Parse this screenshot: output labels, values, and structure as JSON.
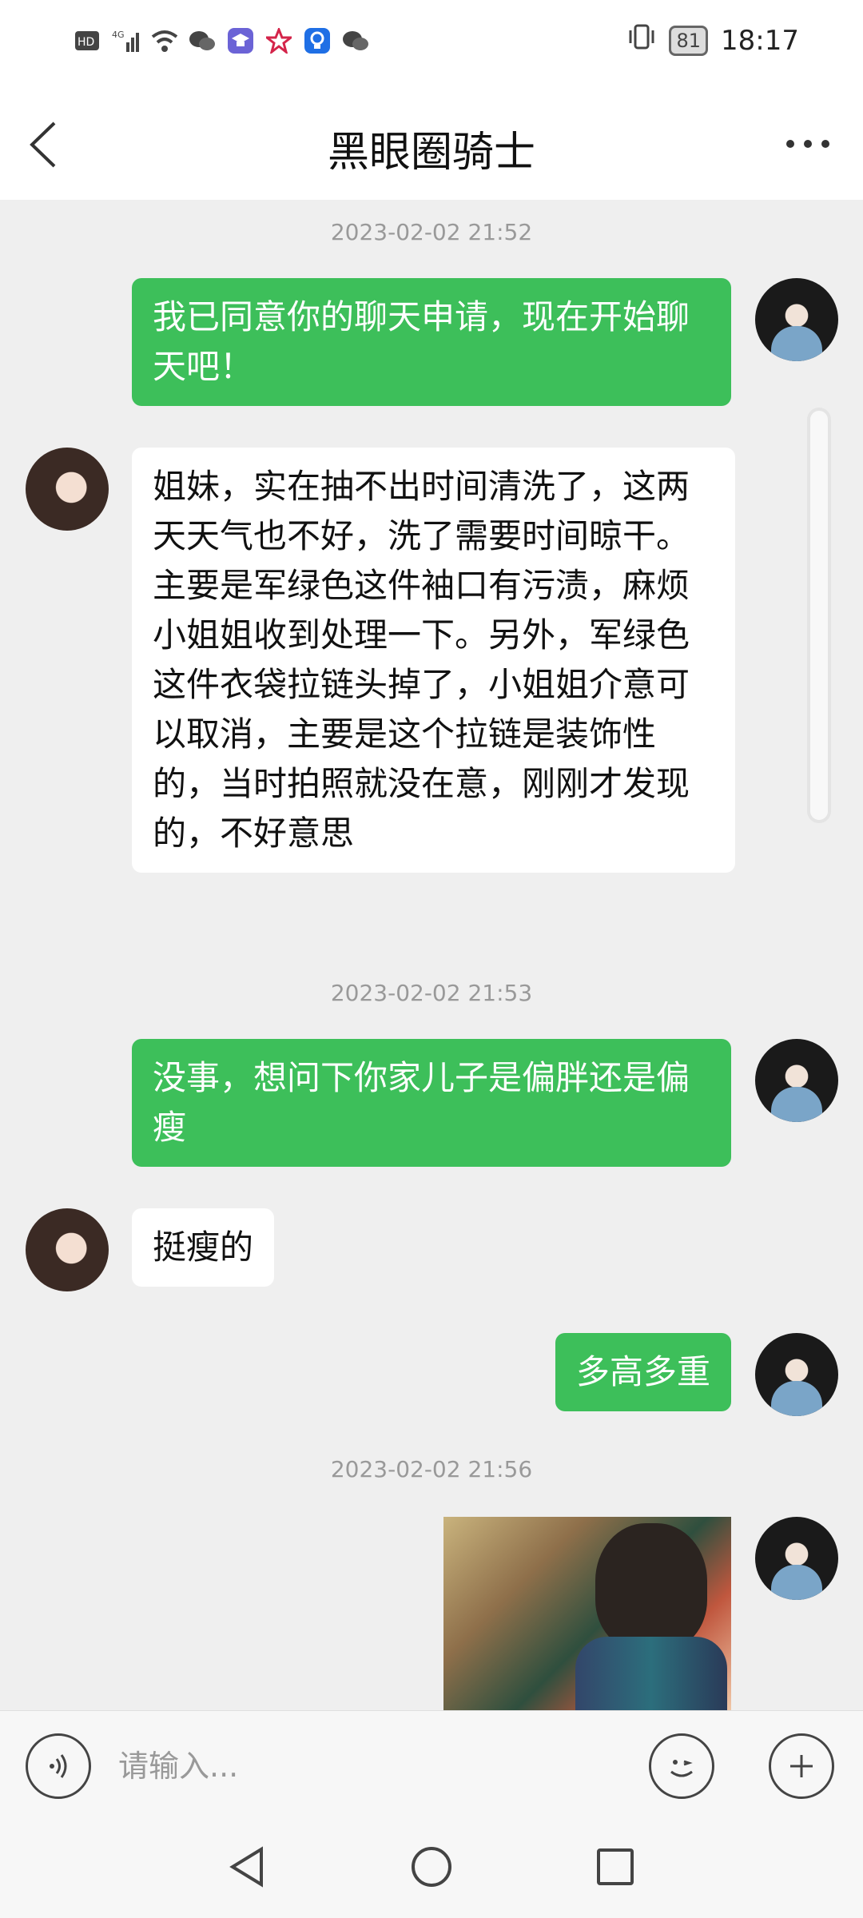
{
  "status_bar": {
    "left_icons": [
      "hd-icon",
      "4g-signal-icon",
      "wifi-icon",
      "wechat-icon",
      "graduation-cap-app-icon",
      "star-app-icon",
      "bulb-app-icon",
      "wechat-icon"
    ],
    "battery": "81",
    "time": "18:17"
  },
  "header": {
    "title": "黑眼圈骑士"
  },
  "timestamps": [
    "2023-02-02 21:52",
    "2023-02-02 21:53",
    "2023-02-02 21:56"
  ],
  "messages": [
    {
      "direction": "out",
      "text": "我已同意你的聊天申请，现在开始聊天吧！"
    },
    {
      "direction": "in",
      "text": "姐妹，实在抽不出时间清洗了，这两天天气也不好，洗了需要时间晾干。主要是军绿色这件袖口有污渍，麻烦小姐姐收到处理一下。另外，军绿色这件衣袋拉链头掉了，小姐姐介意可以取消，主要是这个拉链是装饰性的，当时拍照就没在意，刚刚才发现的，不好意思"
    },
    {
      "direction": "out",
      "text": "没事，想问下你家儿子是偏胖还是偏瘦"
    },
    {
      "direction": "in",
      "text": "挺瘦的"
    },
    {
      "direction": "out",
      "text": "多高多重"
    }
  ],
  "input": {
    "placeholder": "请输入..."
  },
  "icons": {
    "voice": "voice-icon",
    "emoji": "emoji-icon",
    "add": "plus-icon"
  }
}
